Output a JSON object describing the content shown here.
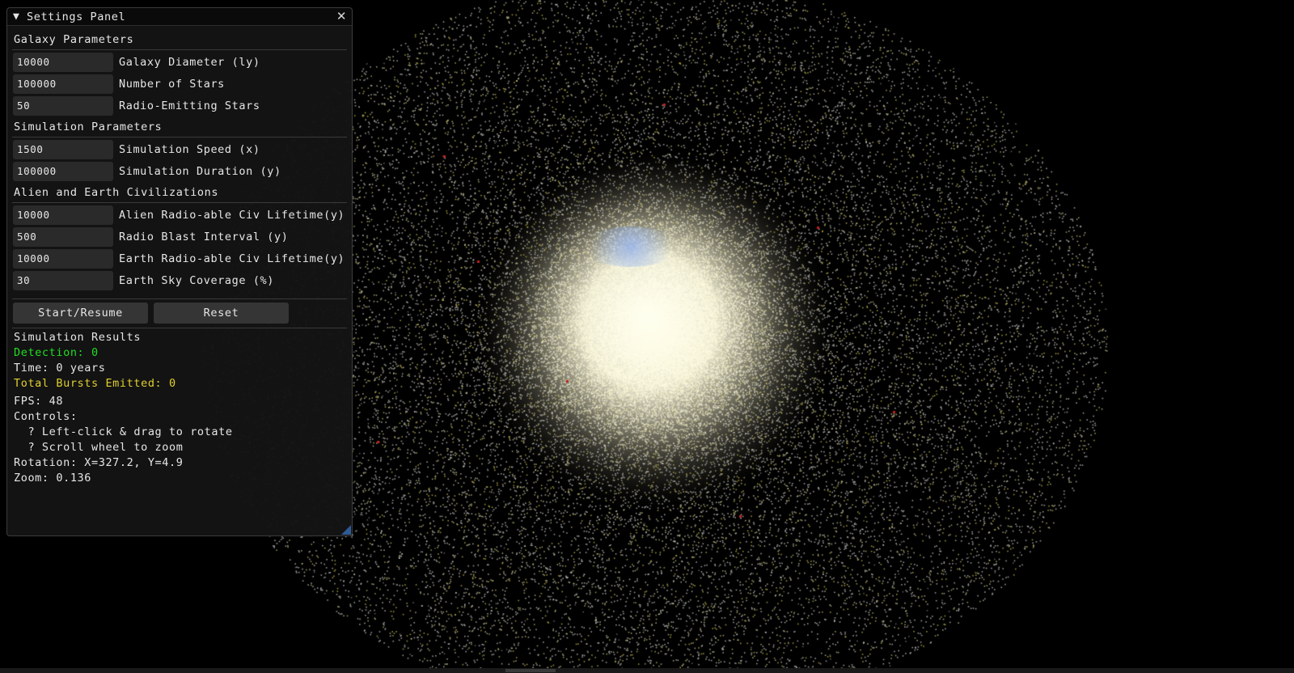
{
  "panel": {
    "title": "Settings Panel",
    "collapse_icon": "▼",
    "close_icon": "✕"
  },
  "galaxy_parameters": {
    "header": "Galaxy Parameters",
    "galaxy_diameter": {
      "value": "10000",
      "label": "Galaxy Diameter (ly)"
    },
    "number_of_stars": {
      "value": "100000",
      "label": "Number of Stars"
    },
    "radio_emitting_stars": {
      "value": "50",
      "label": "Radio-Emitting Stars"
    }
  },
  "simulation_parameters": {
    "header": "Simulation Parameters",
    "simulation_speed": {
      "value": "1500",
      "label": "Simulation Speed (x)"
    },
    "simulation_duration": {
      "value": "100000",
      "label": "Simulation Duration (y)"
    }
  },
  "civilizations": {
    "header": "Alien and Earth Civilizations",
    "alien_lifetime": {
      "value": "10000",
      "label": "Alien Radio-able Civ Lifetime(y)"
    },
    "radio_blast_interval": {
      "value": "500",
      "label": "Radio Blast Interval (y)"
    },
    "earth_lifetime": {
      "value": "10000",
      "label": "Earth Radio-able Civ Lifetime(y)"
    },
    "earth_sky_coverage": {
      "value": "30",
      "label": "Earth Sky Coverage (%)"
    }
  },
  "buttons": {
    "start_resume": "Start/Resume",
    "reset": "Reset"
  },
  "results": {
    "header": "Simulation Results",
    "detection": "Detection: 0",
    "time": "Time: 0 years",
    "total_bursts": "Total Bursts Emitted: 0",
    "fps": "FPS: 48",
    "controls_header": "Controls:",
    "control_rotate": "  ? Left-click & drag to rotate",
    "control_zoom": "  ? Scroll wheel to zoom",
    "rotation": "Rotation: X=327.2, Y=4.9",
    "zoom": "Zoom: 0.136"
  },
  "colors": {
    "detection": "#22dd22",
    "total_bursts": "#e0d030",
    "accent": "#2e5a96"
  }
}
